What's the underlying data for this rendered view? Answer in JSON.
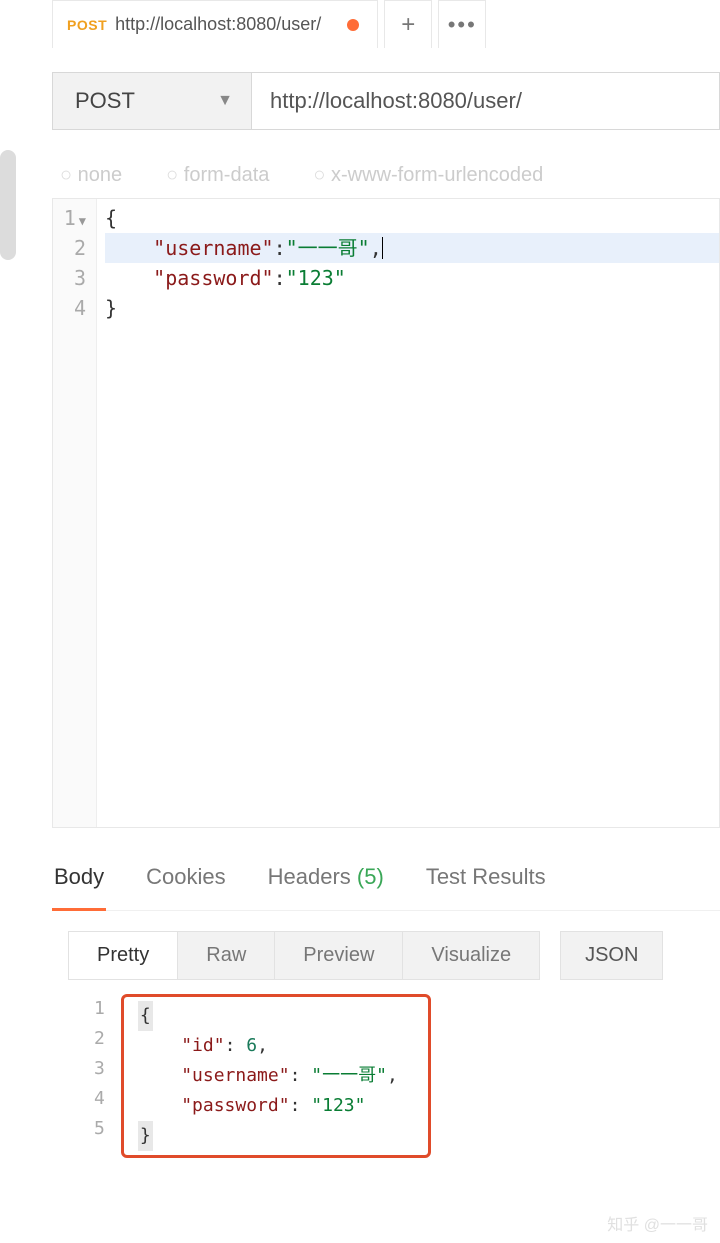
{
  "tab": {
    "method_badge": "POST",
    "title": "http://localhost:8080/user/",
    "unsaved": true
  },
  "request": {
    "method": "POST",
    "url": "http://localhost:8080/user/"
  },
  "body_types": {
    "opt2": "none",
    "opt4": "form-data",
    "opt5": "x-www-form-urlencoded"
  },
  "editor": {
    "lines": [
      "1",
      "2",
      "3",
      "4"
    ],
    "json": {
      "key1": "\"username\"",
      "val1": "\"一一哥\"",
      "key2": "\"password\"",
      "val2": "\"123\""
    }
  },
  "response_tabs": {
    "body": "Body",
    "cookies": "Cookies",
    "headers_label": "Headers",
    "headers_count": "(5)",
    "test": "Test Results"
  },
  "view_modes": {
    "pretty": "Pretty",
    "raw": "Raw",
    "preview": "Preview",
    "visualize": "Visualize",
    "lang": "JSON"
  },
  "response_body": {
    "lines": [
      "1",
      "2",
      "3",
      "4",
      "5"
    ],
    "json": {
      "k1": "\"id\"",
      "v1": "6",
      "k2": "\"username\"",
      "v2": "\"一一哥\"",
      "k3": "\"password\"",
      "v3": "\"123\""
    }
  },
  "watermark": "知乎 @一一哥"
}
